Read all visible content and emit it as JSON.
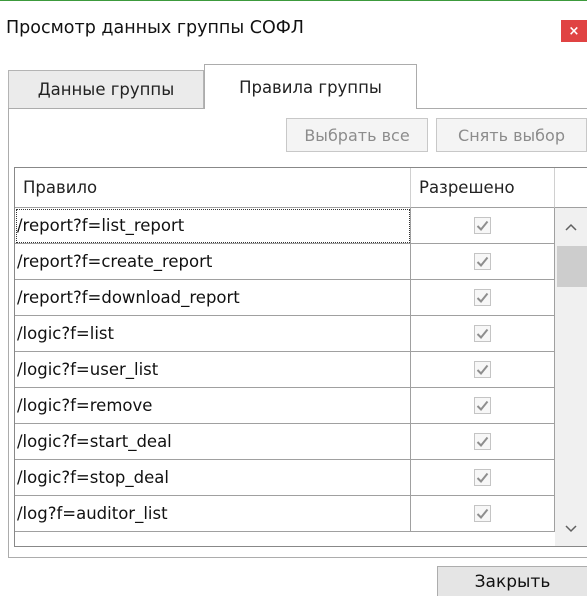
{
  "window": {
    "title": "Просмотр данных группы СОФЛ",
    "close_glyph": "×",
    "accent_color": "#3c9a3c",
    "close_color": "#e04343"
  },
  "tabs": [
    {
      "label": "Данные группы",
      "active": false
    },
    {
      "label": "Правила группы",
      "active": true
    }
  ],
  "toolbar": {
    "select_all_label": "Выбрать все",
    "deselect_label": "Снять выбор"
  },
  "grid": {
    "columns": [
      "Правило",
      "Разрешено"
    ],
    "rows": [
      {
        "rule": "/report?f=list_report",
        "allowed": true
      },
      {
        "rule": "/report?f=create_report",
        "allowed": true
      },
      {
        "rule": "/report?f=download_report",
        "allowed": true
      },
      {
        "rule": "/logic?f=list",
        "allowed": true
      },
      {
        "rule": "/logic?f=user_list",
        "allowed": true
      },
      {
        "rule": "/logic?f=remove",
        "allowed": true
      },
      {
        "rule": "/logic?f=start_deal",
        "allowed": true
      },
      {
        "rule": "/logic?f=stop_deal",
        "allowed": true
      },
      {
        "rule": "/log?f=auditor_list",
        "allowed": true
      }
    ]
  },
  "footer": {
    "close_label": "Закрыть"
  }
}
